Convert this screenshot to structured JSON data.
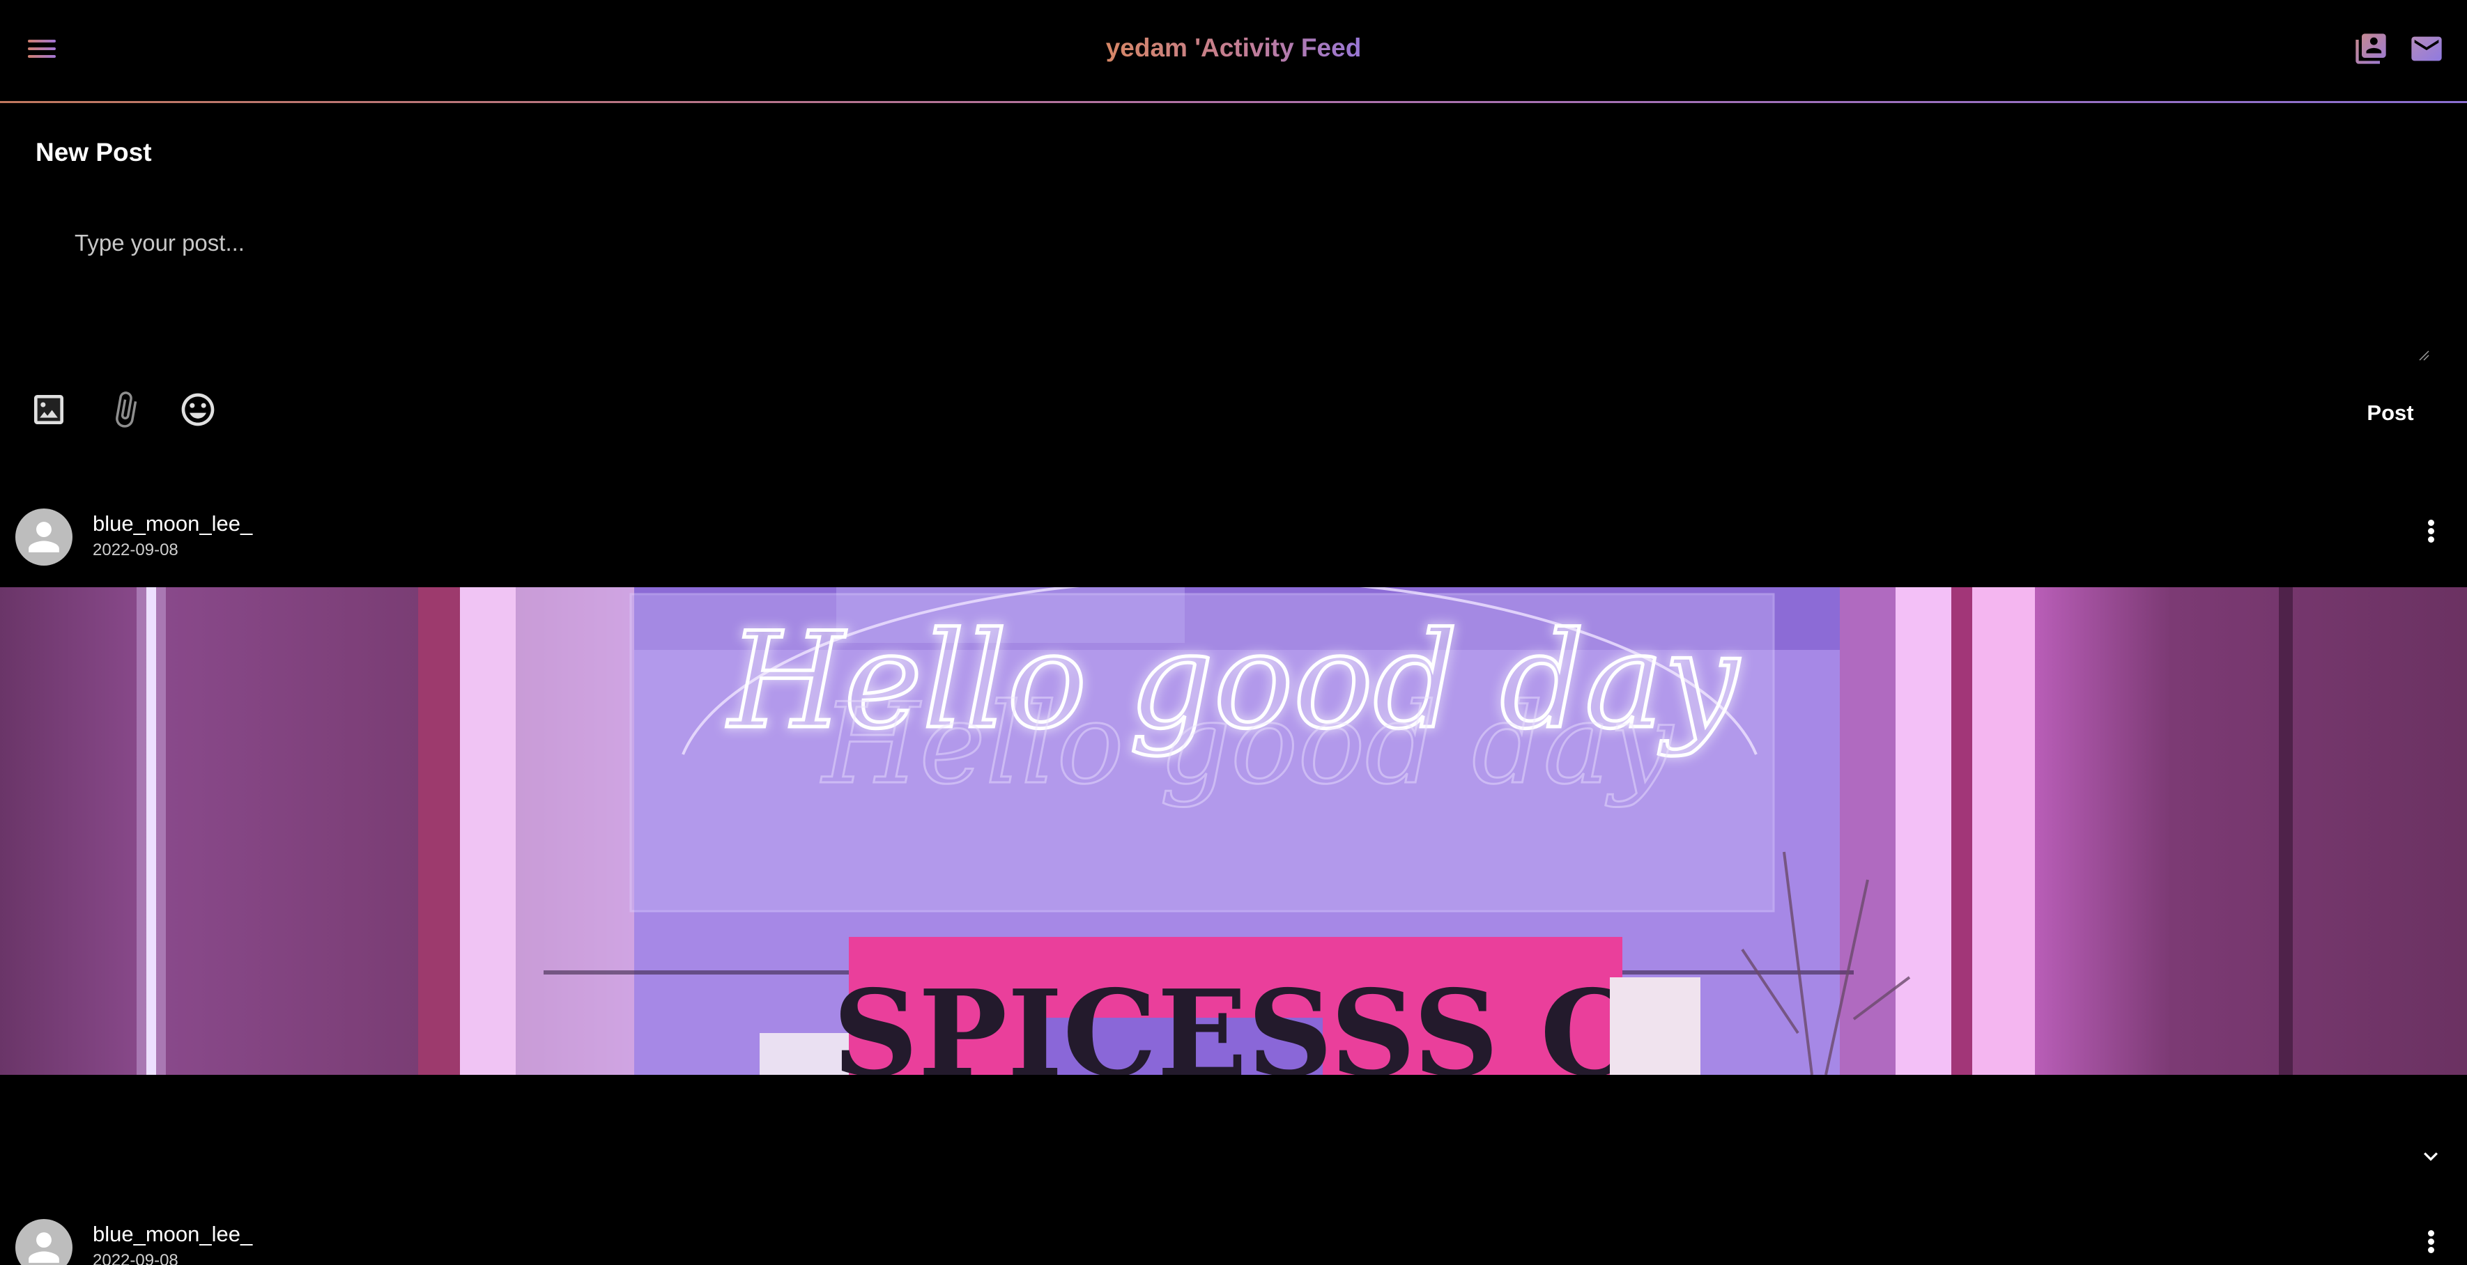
{
  "header": {
    "title": "yedam 'Activity Feed",
    "menu_icon": "menu-icon",
    "contacts_icon": "contacts-book-icon",
    "mail_icon": "mail-icon",
    "accent_start": "#d78766",
    "accent_end": "#8a6fd0"
  },
  "composer": {
    "heading": "New Post",
    "placeholder": "Type your post...",
    "tools": [
      "image-icon",
      "paperclip-icon",
      "emoji-icon"
    ],
    "post_label": "Post"
  },
  "feed": {
    "posts": [
      {
        "username": "blue_moon_lee_",
        "date": "2022-09-08",
        "image_sign_text": "Hello good day",
        "image_board_text": "SPICESSS C"
      },
      {
        "username": "blue_moon_lee_",
        "date": "2022-09-08"
      }
    ]
  }
}
